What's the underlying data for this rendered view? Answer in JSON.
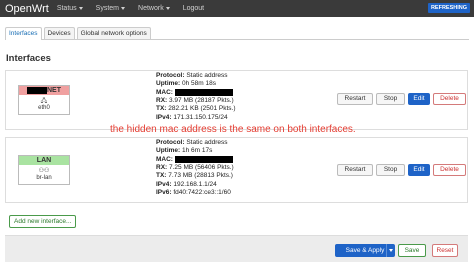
{
  "topbar": {
    "brand": "OpenWrt",
    "menu": [
      "Status",
      "System",
      "Network",
      "Logout"
    ],
    "badge": "REFRESHING"
  },
  "tabs": [
    "Interfaces",
    "Devices",
    "Global network options"
  ],
  "section_title": "Interfaces",
  "interfaces": [
    {
      "name_suffix": "NET",
      "header_color": "#f0a0a0",
      "device": "eth0",
      "info": {
        "protocol_label": "Protocol:",
        "protocol": "Static address",
        "uptime_label": "Uptime:",
        "uptime": "0h 58m 18s",
        "mac_label": "MAC:",
        "rx_label": "RX:",
        "rx": "3.97 MB (28187 Pkts.)",
        "tx_label": "TX:",
        "tx": "282.21 KB (2501 Pkts.)",
        "ipv4_label": "IPv4:",
        "ipv4": "171.31.150.175/24"
      }
    },
    {
      "name": "LAN",
      "header_color": "#a9e3a1",
      "device": "br-lan",
      "info": {
        "protocol_label": "Protocol:",
        "protocol": "Static address",
        "uptime_label": "Uptime:",
        "uptime": "1h 6m 17s",
        "mac_label": "MAC:",
        "rx_label": "RX:",
        "rx": "7.25 MB (56406 Pkts.)",
        "tx_label": "TX:",
        "tx": "7.73 MB (28813 Pkts.)",
        "ipv4_label": "IPv4:",
        "ipv4": "192.168.1.1/24",
        "ipv6_label": "IPv6:",
        "ipv6": "fd40:7422:ce3::1/60"
      }
    }
  ],
  "row_buttons": {
    "restart": "Restart",
    "stop": "Stop",
    "edit": "Edit",
    "delete": "Delete"
  },
  "annotation": "the hidden mac address is the same on both interfaces.",
  "add_interface": "Add new interface...",
  "footer": {
    "save_apply": "Save & Apply",
    "save": "Save",
    "reset": "Reset"
  }
}
